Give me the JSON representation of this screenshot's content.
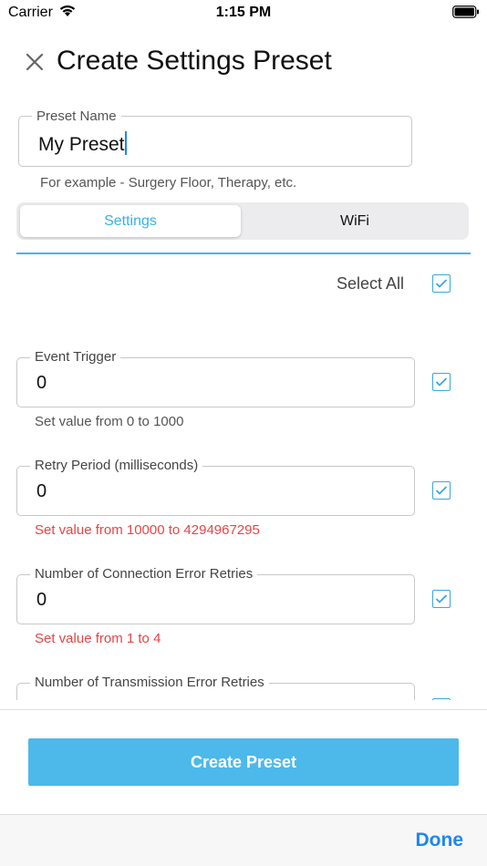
{
  "status_bar": {
    "carrier": "Carrier",
    "time": "1:15 PM"
  },
  "header": {
    "title": "Create Settings Preset",
    "close_icon": "close-icon"
  },
  "preset_name": {
    "label": "Preset Name",
    "value": "My Preset",
    "helper": "For example - Surgery Floor, Therapy, etc."
  },
  "tabs": [
    {
      "label": "Settings",
      "selected": true
    },
    {
      "label": "WiFi",
      "selected": false
    }
  ],
  "select_all": {
    "label": "Select All",
    "checked": true
  },
  "fields": [
    {
      "label": "Event Trigger",
      "value": "0",
      "helper": "Set value from 0 to 1000",
      "helper_status": "normal",
      "checked": true
    },
    {
      "label": "Retry Period (milliseconds)",
      "value": "0",
      "helper": "Set value from 10000 to 4294967295",
      "helper_status": "error",
      "checked": true
    },
    {
      "label": "Number of Connection Error Retries",
      "value": "0",
      "helper": "Set value from 1 to 4",
      "helper_status": "error",
      "checked": true
    },
    {
      "label": "Number of Transmission Error Retries",
      "value": "",
      "helper": "",
      "helper_status": "normal",
      "checked": true
    }
  ],
  "actions": {
    "create_label": "Create Preset",
    "done_label": "Done"
  },
  "colors": {
    "accent": "#4cb9ea",
    "link": "#1e86f0",
    "error": "#e64545",
    "tab_active": "#3ab0e6"
  }
}
